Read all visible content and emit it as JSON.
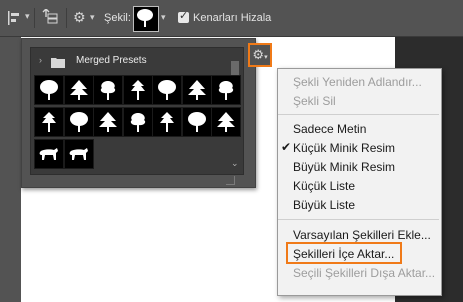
{
  "toolbar": {
    "shape_label": "Şekil:",
    "align_edges_label": "Kenarları Hizala"
  },
  "picker": {
    "folder_name": "Merged Presets",
    "shapes": [
      "tree",
      "tree",
      "tree",
      "tree",
      "tree",
      "tree",
      "tree",
      "tree",
      "tree",
      "tree",
      "tree",
      "tree",
      "tree",
      "tree",
      "animal",
      "animal"
    ]
  },
  "menu": {
    "items": [
      {
        "label": "Şekli Yeniden Adlandır...",
        "enabled": false,
        "checked": false
      },
      {
        "label": "Şekli Sil",
        "enabled": false,
        "checked": false
      },
      {
        "label": "Sadece Metin",
        "enabled": true,
        "checked": false
      },
      {
        "label": "Küçük Minik Resim",
        "enabled": true,
        "checked": true
      },
      {
        "label": "Büyük Minik Resim",
        "enabled": true,
        "checked": false
      },
      {
        "label": "Küçük Liste",
        "enabled": true,
        "checked": false
      },
      {
        "label": "Büyük Liste",
        "enabled": true,
        "checked": false
      },
      {
        "label": "Varsayılan Şekilleri Ekle...",
        "enabled": true,
        "checked": false
      },
      {
        "label": "Şekilleri İçe Aktar...",
        "enabled": true,
        "checked": false
      },
      {
        "label": "Seçili Şekilleri Dışa Aktar...",
        "enabled": false,
        "checked": false
      }
    ]
  },
  "colors": {
    "highlight": "#f07a18",
    "toolbar_bg": "#535353",
    "menu_bg": "#f2f2f2"
  }
}
